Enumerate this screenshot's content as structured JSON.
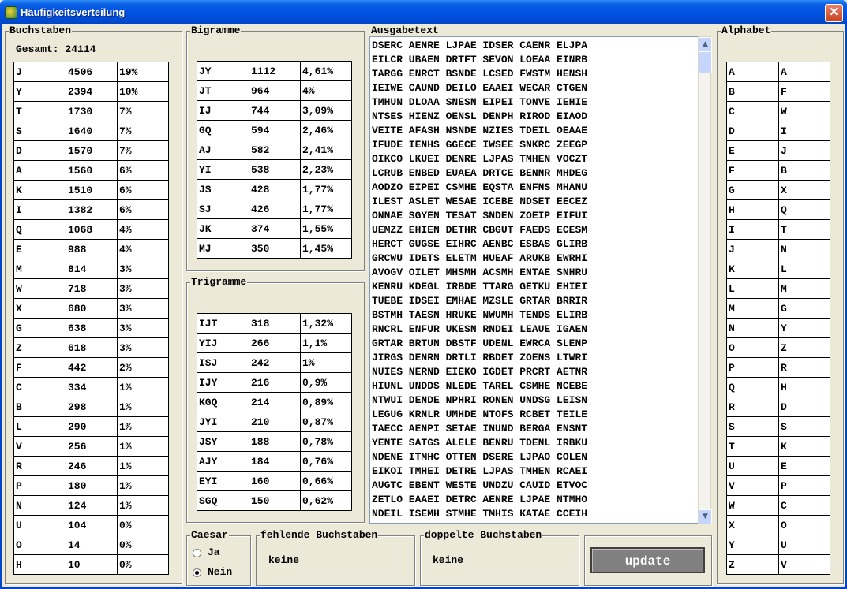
{
  "window": {
    "title": "Häufigkeitsverteilung",
    "close_glyph": "✕"
  },
  "buchstaben": {
    "legend": "Buchstaben",
    "gesamt_label": "Gesamt: 24114",
    "rows": [
      [
        "J",
        "4506",
        "19%"
      ],
      [
        "Y",
        "2394",
        "10%"
      ],
      [
        "T",
        "1730",
        "7%"
      ],
      [
        "S",
        "1640",
        "7%"
      ],
      [
        "D",
        "1570",
        "7%"
      ],
      [
        "A",
        "1560",
        "6%"
      ],
      [
        "K",
        "1510",
        "6%"
      ],
      [
        "I",
        "1382",
        "6%"
      ],
      [
        "Q",
        "1068",
        "4%"
      ],
      [
        "E",
        "988",
        "4%"
      ],
      [
        "M",
        "814",
        "3%"
      ],
      [
        "W",
        "718",
        "3%"
      ],
      [
        "X",
        "680",
        "3%"
      ],
      [
        "G",
        "638",
        "3%"
      ],
      [
        "Z",
        "618",
        "3%"
      ],
      [
        "F",
        "442",
        "2%"
      ],
      [
        "C",
        "334",
        "1%"
      ],
      [
        "B",
        "298",
        "1%"
      ],
      [
        "L",
        "290",
        "1%"
      ],
      [
        "V",
        "256",
        "1%"
      ],
      [
        "R",
        "246",
        "1%"
      ],
      [
        "P",
        "180",
        "1%"
      ],
      [
        "N",
        "124",
        "1%"
      ],
      [
        "U",
        "104",
        "0%"
      ],
      [
        "O",
        "14",
        "0%"
      ],
      [
        "H",
        "10",
        "0%"
      ]
    ]
  },
  "bigramme": {
    "legend": "Bigramme",
    "rows": [
      [
        "JY",
        "1112",
        "4,61%"
      ],
      [
        "JT",
        "964",
        "4%"
      ],
      [
        "IJ",
        "744",
        "3,09%"
      ],
      [
        "GQ",
        "594",
        "2,46%"
      ],
      [
        "AJ",
        "582",
        "2,41%"
      ],
      [
        "YI",
        "538",
        "2,23%"
      ],
      [
        "JS",
        "428",
        "1,77%"
      ],
      [
        "SJ",
        "426",
        "1,77%"
      ],
      [
        "JK",
        "374",
        "1,55%"
      ],
      [
        "MJ",
        "350",
        "1,45%"
      ]
    ]
  },
  "trigramme": {
    "legend": "Trigramme",
    "rows": [
      [
        "IJT",
        "318",
        "1,32%"
      ],
      [
        "YIJ",
        "266",
        "1,1%"
      ],
      [
        "ISJ",
        "242",
        "1%"
      ],
      [
        "IJY",
        "216",
        "0,9%"
      ],
      [
        "KGQ",
        "214",
        "0,89%"
      ],
      [
        "JYI",
        "210",
        "0,87%"
      ],
      [
        "JSY",
        "188",
        "0,78%"
      ],
      [
        "AJY",
        "184",
        "0,76%"
      ],
      [
        "EYI",
        "160",
        "0,66%"
      ],
      [
        "SGQ",
        "150",
        "0,62%"
      ]
    ]
  },
  "ausgabetext": {
    "legend": "Ausgabetext",
    "lines": [
      "DSERC AENRE LJPAE IDSER CAENR ELJPA",
      "EILCR UBAEN DRTFT SEVON LOEAA EINRB",
      "TARGG ENRCT BSNDE LCSED FWSTM HENSH",
      "IEIWE CAUND DEILO EAAEI WECAR CTGEN",
      "TMHUN DLOAA SNESN EIPEI TONVE IEHIE",
      "NTSES HIENZ OENSL DENPH RIROD EIAOD",
      "VEITE AFASH NSNDE NZIES TDEIL OEAAE",
      "IFUDE IENHS GGECE IWSEE SNKRC ZEEGP",
      "OIKCO LKUEI DENRE LJPAS TMHEN VOCZT",
      "LCRUB ENBED EUAEA DRTCE BENNR MHDEG",
      "AODZO EIPEI CSMHE EQSTA ENFNS MHANU",
      "ILEST ASLET WESAE ICEBE NDSET EECEZ",
      "ONNAE SGYEN TESAT SNDEN ZOEIP EIFUI",
      "UEMZZ EHIEN DETHR CBGUT FAEDS ECESM",
      "HERCT GUGSE EIHRC AENBC ESBAS GLIRB",
      "GRCWU IDETS ELETM HUEAF ARUKB EWRHI",
      "AVOGV OILET MHSMH ACSMH ENTAE SNHRU",
      "KENRU KDEGL IRBDE TTARG GETKU EHIEI",
      "TUEBE IDSEI EMHAE MZSLE GRTAR BRRIR",
      "BSTMH TAESN HRUKE NWUMH TENDS ELIRB",
      "RNCRL ENFUR UKESN RNDEI LEAUE IGAEN",
      "GRTAR BRTUN DBSTF UDENL EWRCA SLENP",
      "JIRGS DENRN DRTLI RBDET ZOENS LTWRI",
      "NUIES NERND EIEKO IGDET PRCRT AETNR",
      "HIUNL UNDDS NLEDE TAREL CSMHE NCEBE",
      "NTWUI DENDE NPHRI RONEN UNDSG LEISN",
      "LEGUG KRNLR UMHDE NTOFS RCBET TEILE",
      "TAECC AENPI SETAE INUND BERGA ENSNT",
      "YENTE SATGS ALELE BENRU TDENL IRBKU",
      "NDENE ITMHC OTTEN DSERE LJPAO COLEN",
      "EIKOI TMHEI DETRE LJPAS TMHEN RCAEI",
      "AUGTC EBENT WESTE UNDZU CAUID ETVOC",
      "ZETLO EAAEI DETRC AENRE LJPAE NTMHO",
      "NDEIL ISEMH STMHE TMHIS KATAE CCEIH"
    ],
    "scroll_up": "▲",
    "scroll_down": "▼"
  },
  "caesar": {
    "legend": "Caesar",
    "options": [
      "Ja",
      "Nein"
    ],
    "selected": "Nein"
  },
  "fehlende": {
    "legend": "fehlende Buchstaben",
    "value": "keine"
  },
  "doppelte": {
    "legend": "doppelte Buchstaben",
    "value": "keine"
  },
  "update_label": "update",
  "alphabet": {
    "legend": "Alphabet",
    "rows": [
      [
        "A",
        "A"
      ],
      [
        "B",
        "F"
      ],
      [
        "C",
        "W"
      ],
      [
        "D",
        "I"
      ],
      [
        "E",
        "J"
      ],
      [
        "F",
        "B"
      ],
      [
        "G",
        "X"
      ],
      [
        "H",
        "Q"
      ],
      [
        "I",
        "T"
      ],
      [
        "J",
        "N"
      ],
      [
        "K",
        "L"
      ],
      [
        "L",
        "M"
      ],
      [
        "M",
        "G"
      ],
      [
        "N",
        "Y"
      ],
      [
        "O",
        "Z"
      ],
      [
        "P",
        "R"
      ],
      [
        "Q",
        "H"
      ],
      [
        "R",
        "D"
      ],
      [
        "S",
        "S"
      ],
      [
        "T",
        "K"
      ],
      [
        "U",
        "E"
      ],
      [
        "V",
        "P"
      ],
      [
        "W",
        "C"
      ],
      [
        "X",
        "O"
      ],
      [
        "Y",
        "U"
      ],
      [
        "Z",
        "V"
      ]
    ]
  }
}
